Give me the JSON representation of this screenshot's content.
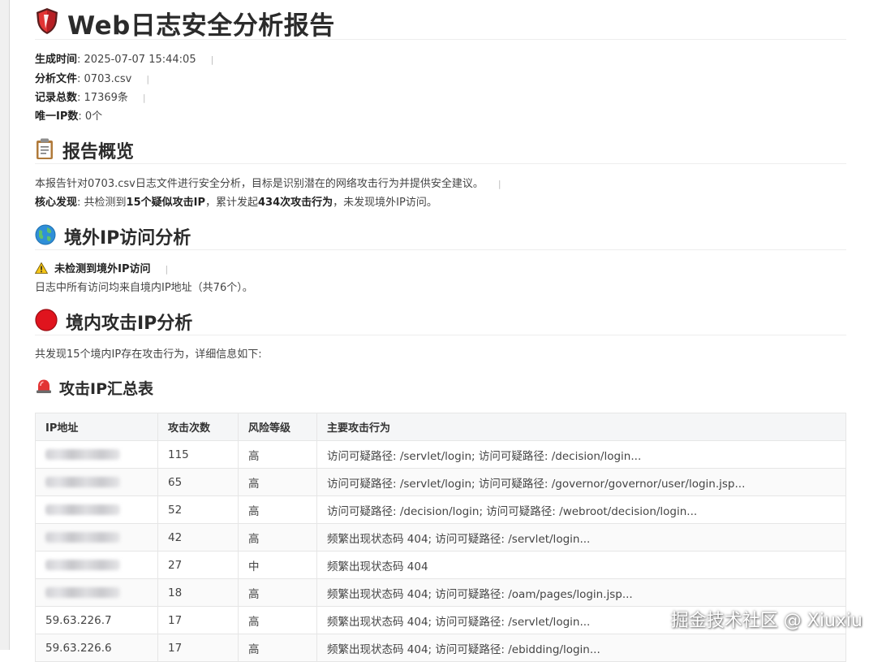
{
  "report": {
    "title": "Web日志安全分析报告",
    "meta": [
      {
        "label": "生成时间",
        "value": ": 2025-07-07 15:44:05"
      },
      {
        "label": "分析文件",
        "value": ": 0703.csv"
      },
      {
        "label": "记录总数",
        "value": ": 17369条"
      },
      {
        "label": "唯一IP数",
        "value": ": 0个"
      }
    ]
  },
  "overview": {
    "heading": "报告概览",
    "intro": "本报告针对0703.csv日志文件进行安全分析，目标是识别潜在的网络攻击行为并提供安全建议。",
    "finding_label": "核心发现",
    "finding_p1": ": 共检测到",
    "finding_b1": "15个疑似攻击IP",
    "finding_p2": "，累计发起",
    "finding_b2": "434次攻击行为",
    "finding_p3": "，未发现境外IP访问。"
  },
  "foreign": {
    "heading": "境外IP访问分析",
    "warning": "未检测到境外IP访问",
    "detail": "日志中所有访问均来自境内IP地址（共76个）。"
  },
  "domestic": {
    "heading": "境内攻击IP分析",
    "intro": "共发现15个境内IP存在攻击行为，详细信息如下:"
  },
  "summary": {
    "heading": "攻击IP汇总表",
    "columns": [
      "IP地址",
      "攻击次数",
      "风险等级",
      "主要攻击行为"
    ],
    "rows": [
      {
        "ip": "",
        "count": "115",
        "risk": "高",
        "behavior": "访问可疑路径: /servlet/login; 访问可疑路径: /decision/login..."
      },
      {
        "ip": "",
        "count": "65",
        "risk": "高",
        "behavior": "访问可疑路径: /servlet/login; 访问可疑路径: /governor/governor/user/login.jsp..."
      },
      {
        "ip": "",
        "count": "52",
        "risk": "高",
        "behavior": "访问可疑路径: /decision/login; 访问可疑路径: /webroot/decision/login..."
      },
      {
        "ip": "",
        "count": "42",
        "risk": "高",
        "behavior": "频繁出现状态码 404; 访问可疑路径: /servlet/login..."
      },
      {
        "ip": "",
        "count": "27",
        "risk": "中",
        "behavior": "频繁出现状态码 404"
      },
      {
        "ip": "",
        "count": "18",
        "risk": "高",
        "behavior": "频繁出现状态码 404; 访问可疑路径: /oam/pages/login.jsp..."
      },
      {
        "ip": "59.63.226.7",
        "count": "17",
        "risk": "高",
        "behavior": "频繁出现状态码 404; 访问可疑路径: /servlet/login..."
      },
      {
        "ip": "59.63.226.6",
        "count": "17",
        "risk": "高",
        "behavior": "频繁出现状态码 404; 访问可疑路径: /ebidding/login..."
      }
    ]
  },
  "watermark": "掘金技术社区 @ Xiuxiu",
  "icons": {
    "title": "shield-icon",
    "overview": "clipboard-icon",
    "foreign": "globe-icon",
    "warning": "warning-icon",
    "domestic": "red-circle-icon",
    "summary": "siren-icon"
  },
  "colors": {
    "shield_red": "#d9262c",
    "alert_red": "#e0141e",
    "globe_blue": "#2f8fd8",
    "warning_yellow": "#f5c518"
  }
}
